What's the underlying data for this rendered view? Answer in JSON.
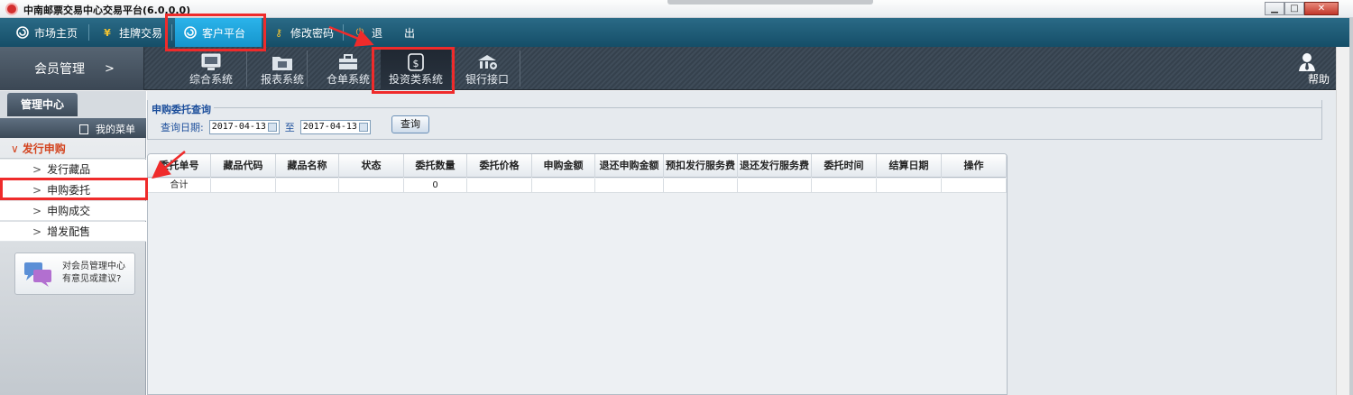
{
  "window": {
    "title": "中南邮票交易中心交易平台(6.0.0.0)",
    "min": "▁",
    "max": "□",
    "close": "✕"
  },
  "menubar": {
    "items": [
      {
        "label": "市场主页",
        "icon": "globe-icon"
      },
      {
        "label": "挂牌交易",
        "icon": "yen-icon"
      },
      {
        "label": "客户平台",
        "icon": "globe-icon",
        "active": true
      },
      {
        "label": "修改密码",
        "icon": "key-icon"
      },
      {
        "label": "退　出",
        "icon": "power-icon"
      }
    ]
  },
  "toolbar": {
    "section": "会员管理",
    "section_arrow": ">",
    "tools": [
      {
        "label": "综合系统",
        "icon": "monitor-icon"
      },
      {
        "label": "报表系统",
        "icon": "folder-icon"
      },
      {
        "label": "仓单系统",
        "icon": "briefcase-icon"
      },
      {
        "label": "投资类系统",
        "icon": "finance-icon",
        "active": true
      },
      {
        "label": "银行接口",
        "icon": "bank-icon"
      }
    ],
    "help": "帮助"
  },
  "sidebar": {
    "tab": "管理中心",
    "my_menu": "我的菜单",
    "group": {
      "label": "发行申购",
      "chevron": "∨"
    },
    "items": [
      {
        "label": "发行藏品"
      },
      {
        "label": "申购委托",
        "highlighted": true
      },
      {
        "label": "申购成交"
      },
      {
        "label": "增发配售"
      }
    ],
    "item_chevron": ">",
    "feedback": {
      "line1": "对会员管理中心",
      "line2": "有意见或建议?"
    }
  },
  "query": {
    "title": "申购委托查询",
    "date_label": "查询日期:",
    "start_date": "2017-04-13",
    "to_label": "至",
    "end_date": "2017-04-13",
    "button": "查询"
  },
  "grid": {
    "columns": [
      "委托单号",
      "藏品代码",
      "藏品名称",
      "状态",
      "委托数量",
      "委托价格",
      "申购金额",
      "退还申购金额",
      "预扣发行服务费",
      "退还发行服务费",
      "委托时间",
      "结算日期",
      "操作"
    ],
    "total_row": [
      "合计",
      "",
      "",
      "",
      "0",
      "",
      "",
      "",
      "",
      "",
      "",
      "",
      ""
    ]
  },
  "colors": {
    "menubar": "#1d5b78",
    "active_menu": "#1fa3dd",
    "toolbar": "#3a4652",
    "highlight": "#ef2b2b",
    "group_text": "#d3441f",
    "query_text": "#1d4f9c"
  }
}
